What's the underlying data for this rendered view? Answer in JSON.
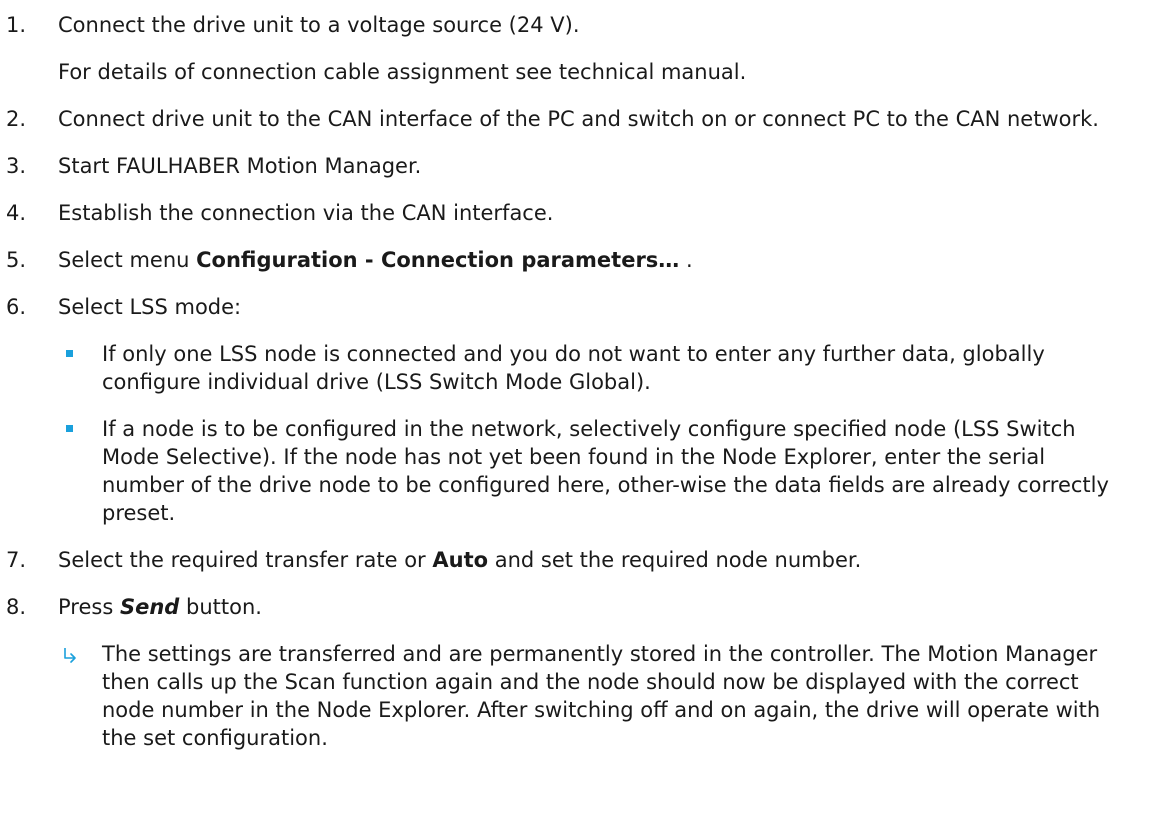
{
  "steps": [
    {
      "num": "1.",
      "text": "Connect the drive unit to a voltage source (24 V).",
      "sub": "For details of connection cable assignment see technical manual."
    },
    {
      "num": "2.",
      "text": "Connect drive unit to the CAN interface of the PC and switch on or connect PC to the CAN network."
    },
    {
      "num": "3.",
      "text": "Start FAULHABER Motion Manager."
    },
    {
      "num": "4.",
      "text": "Establish the connection via the CAN interface."
    },
    {
      "num": "5.",
      "prefix": "Select menu ",
      "bold": "Configuration - Connection parameters…",
      "suffix": " ."
    },
    {
      "num": "6.",
      "text": "Select LSS mode:",
      "bullets": [
        "If only one LSS node is connected and you do not want to enter any further data, globally configure individual drive (LSS Switch Mode Global).",
        "If a node is to be configured in the network, selectively configure specified node (LSS Switch Mode Selective). If the node has not yet been found in the Node Explorer, enter the serial number of the drive node to be configured here, other-wise the data fields are already correctly preset."
      ]
    },
    {
      "num": "7.",
      "prefix": "Select the required transfer rate or ",
      "bold": "Auto",
      "suffix": " and set the required node number."
    },
    {
      "num": "8.",
      "prefix": "Press ",
      "bold_italic": "Send",
      "suffix": " button.",
      "result": "The settings are transferred and are permanently stored in the controller. The Motion Manager then calls up the Scan function again and the node should now be displayed with the correct node number in the Node Explorer. After switching off and on again, the drive will operate with the set configuration."
    }
  ],
  "colors": {
    "text": "#1a1a1a",
    "accent": "#1aa0dc"
  },
  "icons": {
    "bullet": "square-bullet-icon",
    "result": "result-arrow-icon"
  }
}
